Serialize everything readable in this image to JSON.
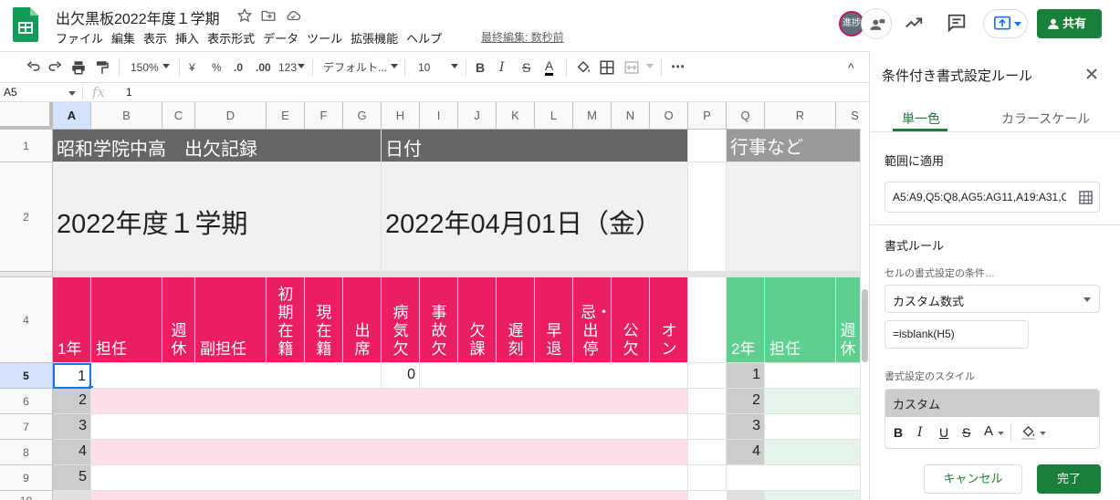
{
  "app": {
    "doc_title": "出欠黒板2022年度１学期",
    "menus": [
      "ファイル",
      "編集",
      "表示",
      "挿入",
      "表示形式",
      "データ",
      "ツール",
      "拡張機能",
      "ヘルプ"
    ],
    "last_edit": "最終編集: 数秒前",
    "avatar_text": "進捗",
    "share_label": "共有"
  },
  "toolbar": {
    "zoom": "150%",
    "currency": "¥",
    "percent": "%",
    "dec_decrease": ".0",
    "dec_increase": ".00",
    "number_format": "123",
    "font": "デフォルト...",
    "font_size": "10",
    "bold": "B",
    "italic": "I",
    "strike": "S",
    "text_color": "A",
    "more": "⋯",
    "collapse": "^"
  },
  "formula_bar": {
    "cell_ref": "A5",
    "fx": "fx",
    "value": "1"
  },
  "sheet": {
    "columns": [
      "A",
      "B",
      "C",
      "D",
      "E",
      "F",
      "G",
      "H",
      "I",
      "J",
      "K",
      "L",
      "M",
      "N",
      "O",
      "P",
      "Q",
      "R",
      "S"
    ],
    "rows": [
      "1",
      "2",
      "4",
      "5",
      "6",
      "7",
      "8",
      "9",
      "10"
    ],
    "title_cell": "昭和学院中高　出欠記録",
    "date_label": "日付",
    "events_label": "行事など",
    "term_cell": "2022年度１学期",
    "date_cell": "2022年04月01日（金）",
    "header_1": [
      "1年",
      "担任",
      "週休",
      "副担任",
      "初期在籍",
      "現在籍",
      "出席",
      "病気欠",
      "事故欠",
      "欠課",
      "遅刻",
      "早退",
      "忌・出停",
      "公欠",
      "オン"
    ],
    "header_2": [
      "2年",
      "担任",
      "週休"
    ],
    "grade1_rows": [
      "1",
      "2",
      "3",
      "4",
      "5"
    ],
    "h5_value": "0",
    "grade2_rows": [
      "1",
      "2",
      "3",
      "4"
    ]
  },
  "panel": {
    "title": "条件付き書式設定ルール",
    "tab_single": "単一色",
    "tab_scale": "カラースケール",
    "range_label": "範囲に適用",
    "range_value": "A5:A9,Q5:Q8,AG5:AG11,A19:A31,C",
    "rules_label": "書式ルール",
    "condition_label": "セルの書式設定の条件…",
    "condition_value": "カスタム数式",
    "formula_value": "=isblank(H5)",
    "style_label": "書式設定のスタイル",
    "style_name": "カスタム",
    "style_buttons": [
      "B",
      "I",
      "U",
      "S",
      "A"
    ],
    "cancel": "キャンセル",
    "done": "完了"
  },
  "colors": {
    "accent_pink": "#e91e63",
    "light_pink": "#fcdfe7",
    "accent_green": "#5ecf8f",
    "light_green": "#e6f4ea",
    "header_gray": "#666666",
    "gray_cell": "#cccccc",
    "share_green": "#188038"
  },
  "icons": [
    "sheets-logo",
    "star-icon",
    "move-folder-icon",
    "cloud-icon",
    "trend-icon",
    "comment-icon",
    "present-icon",
    "person-icon",
    "undo-icon",
    "redo-icon",
    "print-icon",
    "paint-format-icon",
    "fill-color-icon",
    "borders-icon",
    "merge-icon",
    "close-icon",
    "grid-select-icon",
    "dropdown-caret-icon"
  ]
}
